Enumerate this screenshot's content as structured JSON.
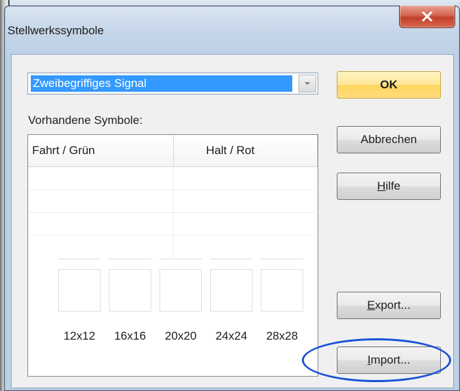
{
  "window": {
    "title": "Stellwerkssymbole",
    "close_icon": "close-icon"
  },
  "signal_type": {
    "selected": "Zweibegriffiges Signal"
  },
  "symbols": {
    "label": "Vorhandene Symbole:",
    "columns": [
      "Fahrt / Grün",
      "Halt / Rot"
    ],
    "sizes": [
      "12x12",
      "16x16",
      "20x20",
      "24x24",
      "28x28"
    ]
  },
  "buttons": {
    "ok": "OK",
    "cancel": "Abbrechen",
    "help_prefix": "H",
    "help_rest": "ilfe",
    "export_prefix": "E",
    "export_rest": "xport...",
    "import_prefix": "I",
    "import_rest": "mport..."
  },
  "colors": {
    "selection": "#3399ff",
    "ok_button": "#ffd45e",
    "close_button": "#c2402a",
    "highlight_oval": "#1a52d6"
  }
}
